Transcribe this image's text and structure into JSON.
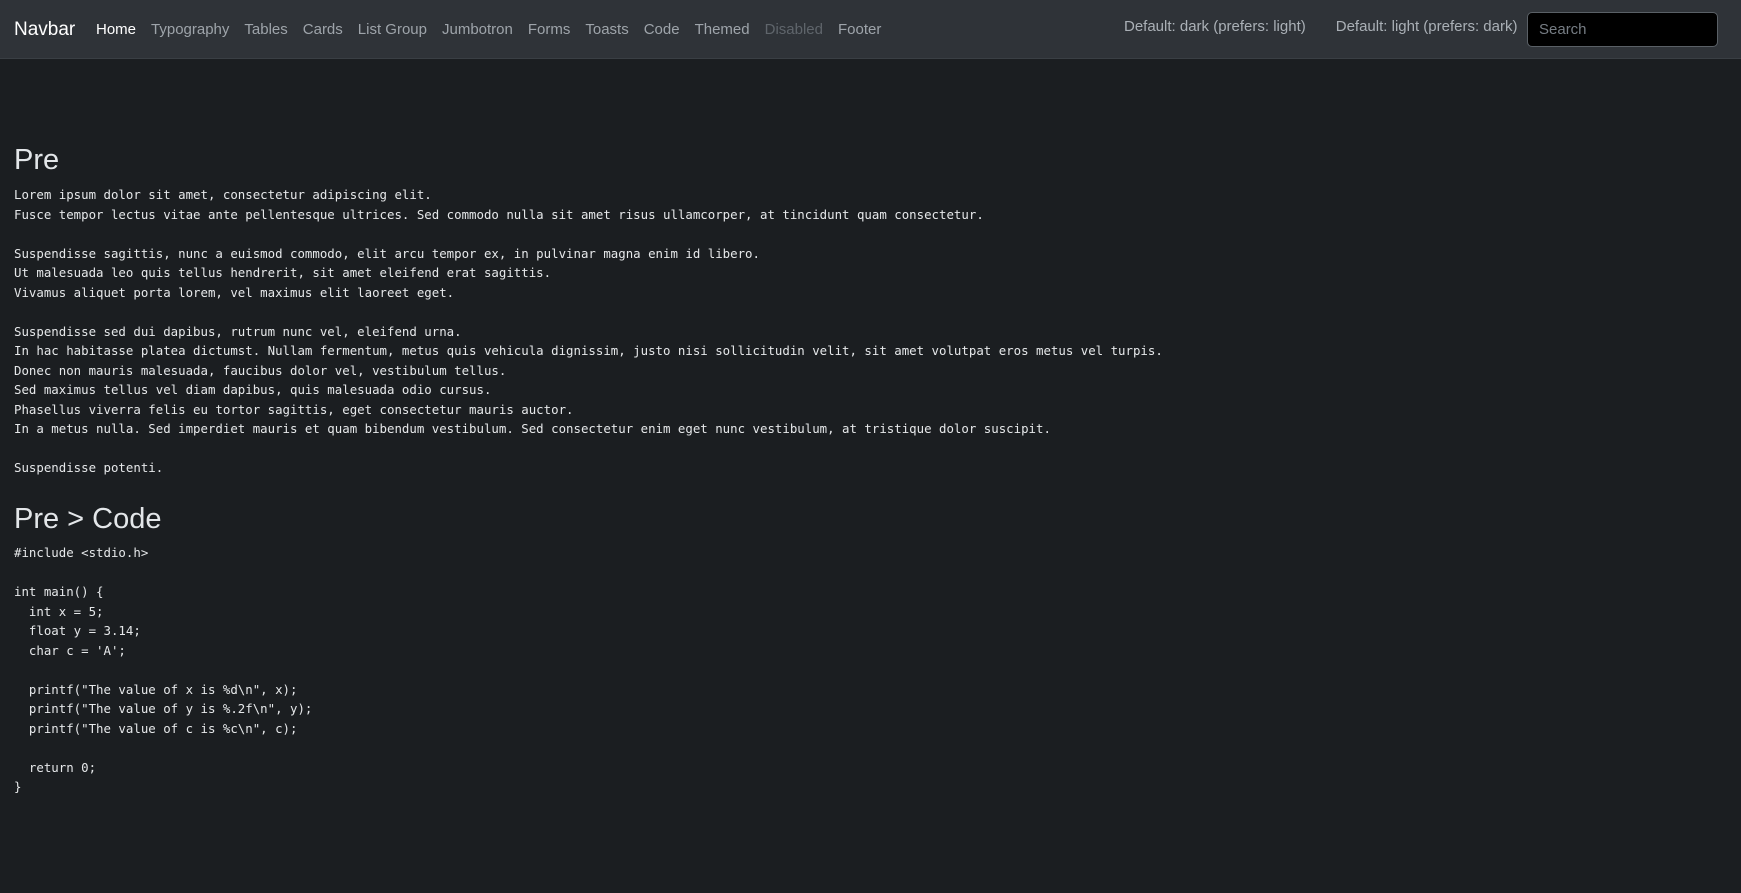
{
  "navbar": {
    "brand": "Navbar",
    "links": [
      {
        "label": "Home",
        "state": "active"
      },
      {
        "label": "Typography",
        "state": "normal"
      },
      {
        "label": "Tables",
        "state": "normal"
      },
      {
        "label": "Cards",
        "state": "normal"
      },
      {
        "label": "List Group",
        "state": "normal"
      },
      {
        "label": "Jumbotron",
        "state": "normal"
      },
      {
        "label": "Forms",
        "state": "normal"
      },
      {
        "label": "Toasts",
        "state": "normal"
      },
      {
        "label": "Code",
        "state": "normal"
      },
      {
        "label": "Themed",
        "state": "normal"
      },
      {
        "label": "Disabled",
        "state": "disabled"
      },
      {
        "label": "Footer",
        "state": "normal"
      }
    ],
    "theme_links": [
      "Default: dark (prefers: light)",
      "Default: light (prefers: dark)"
    ],
    "search_placeholder": "Search",
    "search_value": ""
  },
  "main": {
    "pre_heading": "Pre",
    "pre_text": "Lorem ipsum dolor sit amet, consectetur adipiscing elit.\nFusce tempor lectus vitae ante pellentesque ultrices. Sed commodo nulla sit amet risus ullamcorper, at tincidunt quam consectetur.\n\nSuspendisse sagittis, nunc a euismod commodo, elit arcu tempor ex, in pulvinar magna enim id libero.\nUt malesuada leo quis tellus hendrerit, sit amet eleifend erat sagittis.\nVivamus aliquet porta lorem, vel maximus elit laoreet eget.\n\nSuspendisse sed dui dapibus, rutrum nunc vel, eleifend urna.\nIn hac habitasse platea dictumst. Nullam fermentum, metus quis vehicula dignissim, justo nisi sollicitudin velit, sit amet volutpat eros metus vel turpis.\nDonec non mauris malesuada, faucibus dolor vel, vestibulum tellus.\nSed maximus tellus vel diam dapibus, quis malesuada odio cursus.\nPhasellus viverra felis eu tortor sagittis, eget consectetur mauris auctor.\nIn a metus nulla. Sed imperdiet mauris et quam bibendum vestibulum. Sed consectetur enim eget nunc vestibulum, at tristique dolor suscipit.\n\nSuspendisse potenti.",
    "code_heading": "Pre > Code",
    "code_text": "#include <stdio.h>\n\nint main() {\n  int x = 5;\n  float y = 3.14;\n  char c = 'A';\n\n  printf(\"The value of x is %d\\n\", x);\n  printf(\"The value of y is %.2f\\n\", y);\n  printf(\"The value of c is %c\\n\", c);\n\n  return 0;\n}"
  },
  "colors": {
    "background": "#1b1e21",
    "navbar_background": "#2f3338",
    "link_muted": "#9ea4aa",
    "link_active": "#ffffff",
    "link_disabled": "#5f656b"
  }
}
